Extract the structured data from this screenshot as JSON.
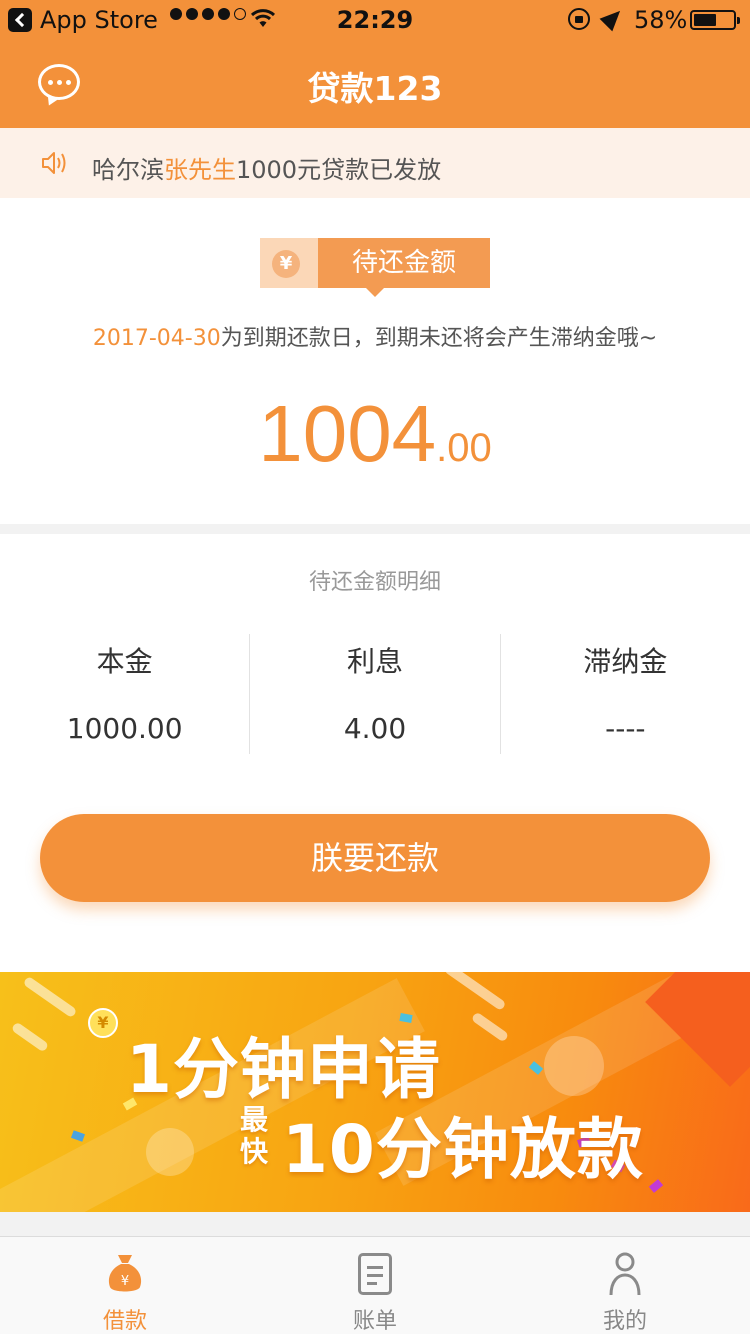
{
  "status_bar": {
    "carrier": "App Store",
    "time": "22:29",
    "battery_percent": "58%",
    "battery_level": 0.58
  },
  "nav": {
    "title": "贷款123",
    "left_icon": "chat-bubble-icon"
  },
  "notice": {
    "icon": "speaker-icon",
    "prefix": "哈尔滨",
    "highlight": "张先生",
    "suffix": "1000元贷款已发放"
  },
  "repayment": {
    "badge_label": "待还金额",
    "badge_icon": "yen-coin-icon",
    "badge_symbol": "¥",
    "due_date": "2017-04-30",
    "due_text": "为到期还款日，到期未还将会产生滞纳金哦~",
    "amount_int": "1004",
    "amount_dec": ".00"
  },
  "detail": {
    "title": "待还金额明细",
    "columns": [
      {
        "label": "本金",
        "value": "1000.00"
      },
      {
        "label": "利息",
        "value": "4.00"
      },
      {
        "label": "滞纳金",
        "value": "----"
      }
    ],
    "repay_button": "朕要还款"
  },
  "banner": {
    "line1": "1分钟申请",
    "small": "最快",
    "line2": "10分钟放款",
    "coin_symbol": "¥"
  },
  "tabs": [
    {
      "label": "借款",
      "icon": "money-bag-icon",
      "active": true
    },
    {
      "label": "账单",
      "icon": "bill-icon",
      "active": false
    },
    {
      "label": "我的",
      "icon": "user-icon",
      "active": false
    }
  ],
  "colors": {
    "primary": "#f3913a",
    "notice_bg": "#fdf1e8",
    "page_bg": "#f2f2f2"
  }
}
